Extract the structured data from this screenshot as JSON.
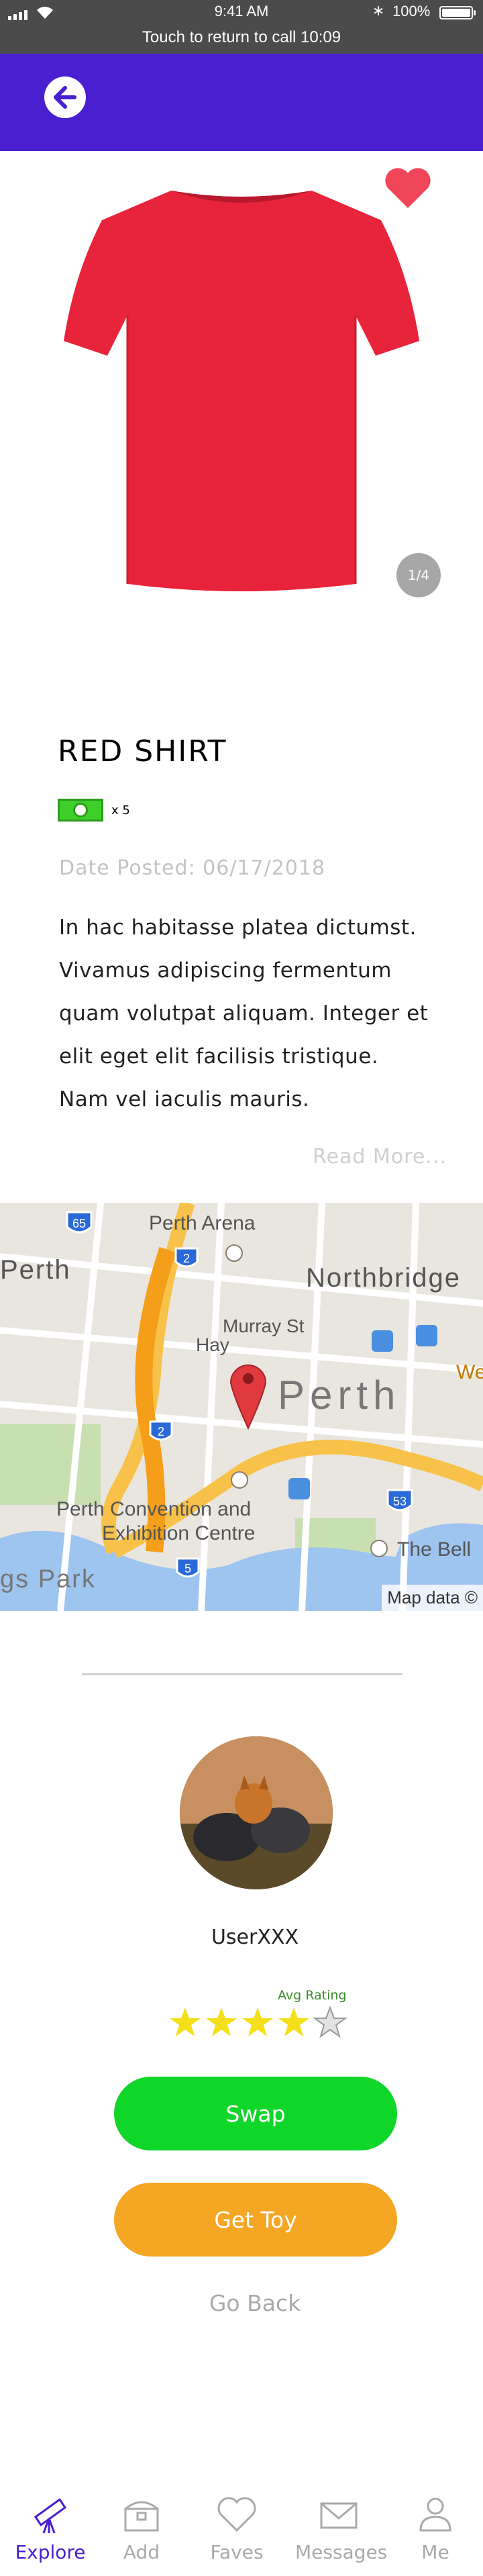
{
  "status_bar": {
    "time": "9:41 AM",
    "call_banner": "Touch to return to call 10:09",
    "battery": "100%"
  },
  "header": {
    "back_icon": "back-arrow-icon",
    "color": "#4a1fd0"
  },
  "product": {
    "title": "RED SHIRT",
    "image_counter": "1/4",
    "price_quantity": "x 5",
    "date_posted": "Date Posted: 06/17/2018",
    "description": "In hac habitasse platea dictumst. Vivamus adipiscing fermentum quam volutpat aliquam. Integer et elit eget elit facilisis tristique. Nam vel iaculis mauris.",
    "read_more": "Read More...",
    "shirt_color": "#e8243c",
    "favorite_color": "#f0465a"
  },
  "map": {
    "labels": {
      "perth_arena": "Perth Arena",
      "perth_west": "Perth",
      "northbridge": "Northbridge",
      "murray_st": "Murray St",
      "hay": "Hay",
      "perth_city": "Perth",
      "we": "We",
      "convention_1": "Perth Convention and",
      "convention_2": "Exhibition Centre",
      "the_bell": "The Bell",
      "gs_park": "gs Park",
      "map_data": "Map data ©"
    },
    "shields": [
      "65",
      "2",
      "2",
      "53",
      "5"
    ]
  },
  "seller": {
    "username": "UserXXX",
    "avg_rating_label": "Avg Rating",
    "rating": 4,
    "rating_max": 5
  },
  "actions": {
    "swap": "Swap",
    "get_toy": "Get Toy",
    "go_back": "Go Back"
  },
  "tabbar": {
    "explore": "Explore",
    "add": "Add",
    "faves": "Faves",
    "messages": "Messages",
    "me": "Me",
    "active": "explore",
    "active_color": "#4a1fd0"
  },
  "colors": {
    "swap_button": "#10d62a",
    "get_toy_button": "#f5a623",
    "star": "#f3e01a"
  }
}
